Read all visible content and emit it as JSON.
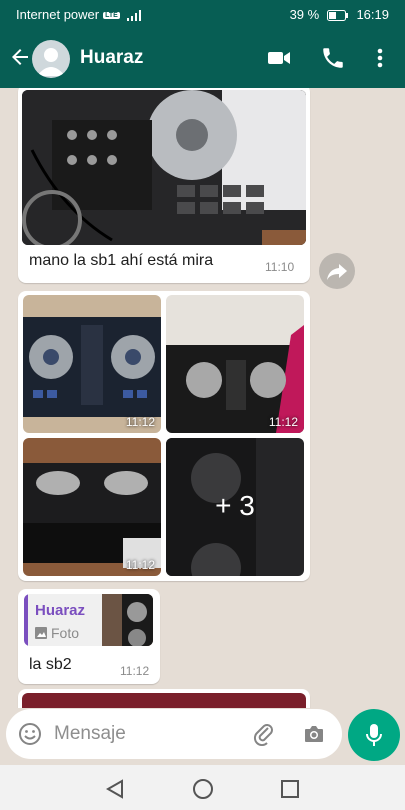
{
  "status_bar": {
    "carrier": "Internet power",
    "network": "LTE",
    "battery": "39 %",
    "time": "16:19"
  },
  "header": {
    "name": "Huaraz"
  },
  "messages": {
    "m1": {
      "text": "mano la sb1 ahí está mira",
      "time": "11:10"
    },
    "album": {
      "time1": "11:12",
      "time2": "11:12",
      "time3": "11:12",
      "more": "+ 3"
    },
    "m3": {
      "quote_author": "Huaraz",
      "quote_type": "Foto",
      "text": "la sb2",
      "time": "11:12"
    }
  },
  "composer": {
    "placeholder": "Mensaje"
  },
  "colors": {
    "header": "#075e54",
    "accent": "#00a884",
    "quote_author": "#7b4fbf"
  }
}
